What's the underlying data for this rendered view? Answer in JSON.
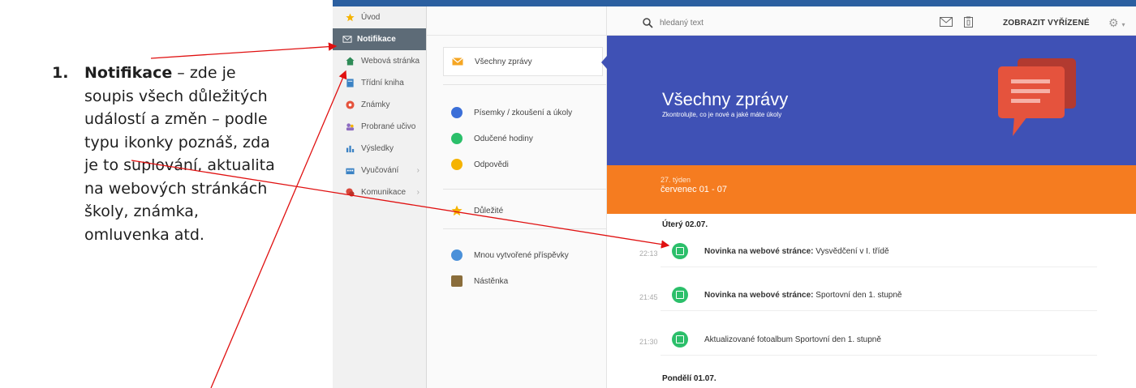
{
  "note": {
    "number": "1.",
    "term": "Notifikace",
    "lines": [
      " – zde je",
      "soupis všech důležitých",
      "událostí a změn – podle",
      "typu ikonky poznáš, zda",
      "je to suplování, aktualita",
      "na webových stránkách",
      "školy, známka,",
      "omluvenka atd."
    ]
  },
  "sidebar": {
    "items": [
      {
        "label": "Úvod",
        "icon": "star-icon",
        "color": "#f5b301"
      },
      {
        "label": "Notifikace",
        "icon": "envelope-icon",
        "color": "#ffffff"
      },
      {
        "label": "Webová stránka",
        "icon": "home-icon",
        "color": "#2e8b57"
      },
      {
        "label": "Třídní kniha",
        "icon": "book-icon",
        "color": "#3b82c4"
      },
      {
        "label": "Známky",
        "icon": "grade-icon",
        "color": "#e5533d"
      },
      {
        "label": "Probrané učivo",
        "icon": "people-icon",
        "color": "#8e6bbf"
      },
      {
        "label": "Výsledky",
        "icon": "bar-chart-icon",
        "color": "#3b82c4"
      },
      {
        "label": "Vyučování",
        "icon": "school-icon",
        "color": "#3b82c4"
      },
      {
        "label": "Komunikace",
        "icon": "chat-icon",
        "color": "#d9483b"
      }
    ]
  },
  "menu": {
    "active": {
      "label": "Všechny zprávy",
      "icon": "envelope-icon",
      "color": "#f5a623"
    },
    "group1": [
      {
        "label": "Písemky / zkoušení a úkoly",
        "icon": "assignment-icon",
        "color": "#3b6fd8"
      },
      {
        "label": "Odučené hodiny",
        "icon": "person-icon",
        "color": "#2bbf6a"
      },
      {
        "label": "Odpovědi",
        "icon": "reply-icon",
        "color": "#f5b301"
      }
    ],
    "important": {
      "label": "Důležité",
      "icon": "star-icon",
      "color": "#f5b301"
    },
    "group3": [
      {
        "label": "Mnou vytvořené příspěvky",
        "icon": "globe-icon",
        "color": "#4a90d9"
      },
      {
        "label": "Nástěnka",
        "icon": "board-icon",
        "color": "#8a6d3b"
      }
    ]
  },
  "header": {
    "search_placeholder": "hledaný text",
    "show_done": "ZOBRAZIT VYŘÍZENÉ"
  },
  "banner": {
    "title": "Všechny zprávy",
    "subtitle": "Zkontrolujte, co je nové a jaké máte úkoly",
    "color": "#3f51b5"
  },
  "week": {
    "label": "27. týden",
    "dates": "červenec 01 - 07",
    "color": "#f57c20"
  },
  "days": [
    {
      "label": "Úterý 02.07."
    },
    {
      "label": "Pondělí 01.07."
    }
  ],
  "messages": [
    {
      "time": "22:13",
      "bold": "Novinka na webové stránce:",
      "text": " Vysvědčení v I. třídě",
      "icon": "web-news-icon"
    },
    {
      "time": "21:45",
      "bold": "Novinka na webové stránce:",
      "text": " Sportovní den 1. stupně",
      "icon": "web-news-icon"
    },
    {
      "time": "21:30",
      "bold": "",
      "text": "Aktualizované fotoalbum Sportovní den 1. stupně",
      "icon": "photo-album-icon"
    }
  ]
}
